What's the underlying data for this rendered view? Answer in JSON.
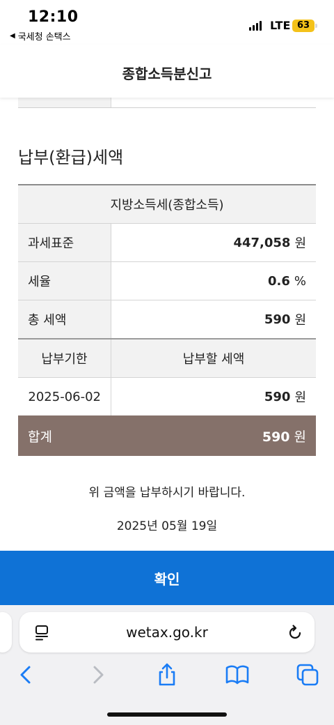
{
  "status_bar": {
    "time": "12:10",
    "back_app": "국세청 손택스",
    "network": "LTE",
    "battery": "63"
  },
  "header": {
    "title": "종합소득분신고"
  },
  "section": {
    "title": "납부(환급)세액"
  },
  "table": {
    "caption": "지방소득세(종합소득)",
    "rows": [
      {
        "label": "과세표준",
        "value": "447,058",
        "unit": "원"
      },
      {
        "label": "세율",
        "value": "0.6",
        "unit": "%"
      },
      {
        "label": "총 세액",
        "value": "590",
        "unit": "원"
      }
    ],
    "columns": [
      "납부기한",
      "납부할 세액"
    ],
    "due": {
      "date": "2025-06-02",
      "amount": "590",
      "unit": "원"
    },
    "total": {
      "label": "합계",
      "value": "590",
      "unit": "원"
    }
  },
  "notice": "위 금액을 납부하시기 바랍니다.",
  "date": "2025년 05월 19일",
  "confirm_label": "확인",
  "browser": {
    "url": "wetax.go.kr"
  },
  "colors": {
    "accent": "#0f72d6",
    "total_bg": "#85716a",
    "safari_blue": "#1a7cf5"
  }
}
